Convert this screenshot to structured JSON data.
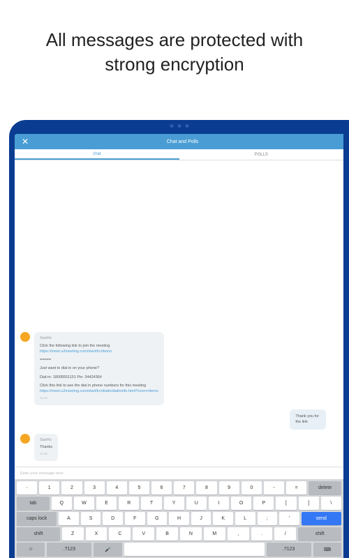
{
  "headline": "All messages are protected with strong encryption",
  "header": {
    "title": "Chat and Polls"
  },
  "tabs": {
    "chat": "chat",
    "polls": "POLLS"
  },
  "messages": {
    "m1": {
      "sender": "StartHo",
      "l1": "Click the following link to join the meeting",
      "link1": "https://meet.u2meeting.com/start/trc/demo",
      "l2": "=====",
      "l3": "Just want to dial in on your phone?",
      "l4": "Dial-in: 18005551151 Pin: 3442436#",
      "l5": "Click this link to see the dial in phone numbers for this meeting",
      "link2": "https://meet.u2meeting.com/start/trc/dialin/dialininfo.html?room=demo",
      "time": "11:24"
    },
    "m2": {
      "text": "Thank you for the link"
    },
    "m3": {
      "sender": "StartHo",
      "text": "Thanks",
      "time": "11:25"
    }
  },
  "input": {
    "placeholder": "Enter your message here"
  },
  "keys": {
    "delete": "delete",
    "tab": "tab",
    "caps": "caps lock",
    "send": "send",
    "shift": "shift",
    "num": ".?123"
  }
}
